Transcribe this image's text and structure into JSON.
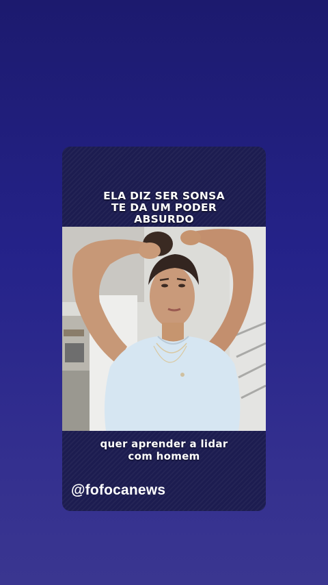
{
  "story": {
    "headline_lines": [
      "ELA DIZ SER SONSA",
      "TE DA UM PODER",
      "ABSURDO"
    ],
    "caption_lines": [
      "quer aprender a lidar",
      "com homem"
    ],
    "handle": "@fofocanews"
  },
  "colors": {
    "background_top": "#1c1a6e",
    "background_bottom": "#3a3690",
    "card": "#1c1c50",
    "text": "#ffffff"
  }
}
